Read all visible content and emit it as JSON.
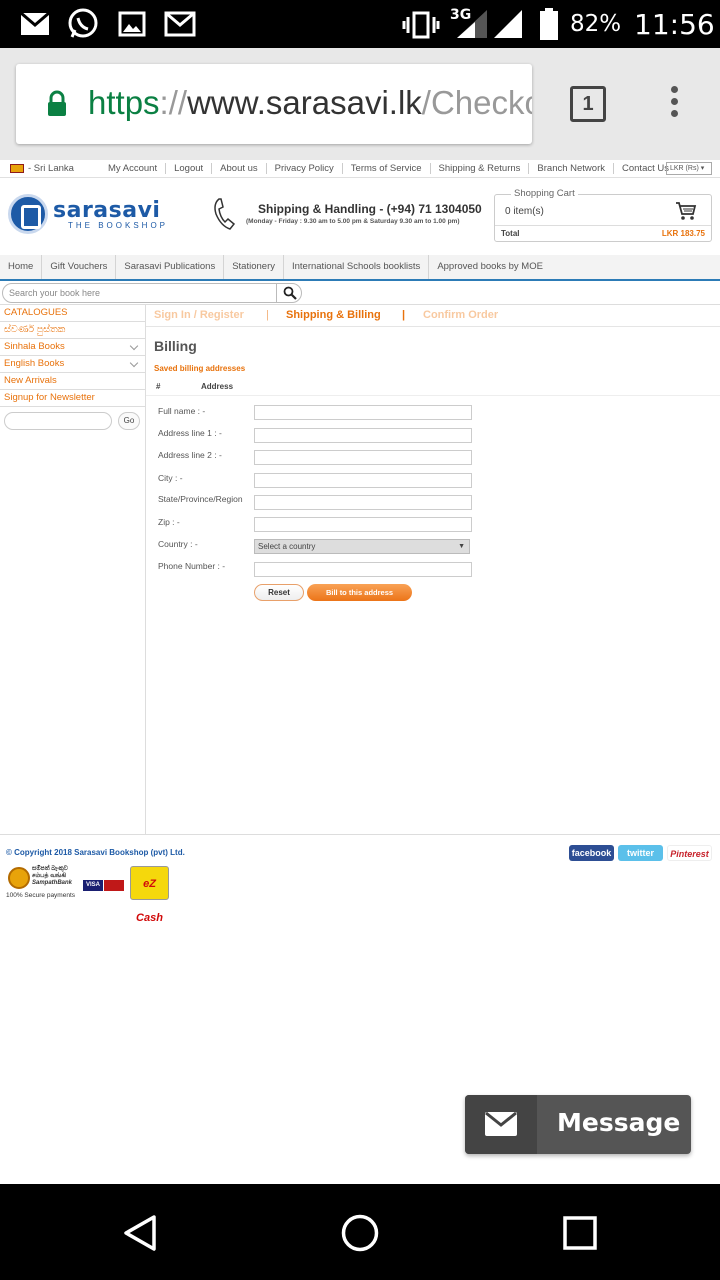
{
  "status_bar": {
    "network": "3G",
    "battery": "82%",
    "time": "11:56"
  },
  "browser": {
    "url_scheme": "https",
    "url_sep": "://",
    "url_host": "www.sarasavi.lk",
    "url_path": "/Checkout",
    "tab_count": "1"
  },
  "top_bar": {
    "country": "- Sri Lanka",
    "links": [
      "My Account",
      "Logout",
      "About us",
      "Privacy Policy",
      "Terms of Service",
      "Shipping & Returns",
      "Branch Network",
      "Contact Us"
    ],
    "currency": "LKR (Rs)"
  },
  "header": {
    "logo_name": "sarasavi",
    "logo_sub": "THE BOOKSHOP",
    "shipping_title": "Shipping & Handling - (+94) 71 1304050",
    "shipping_hours": "(Monday - Friday : 9.30 am to 5.00 pm & Saturday 9.30 am to 1.00 pm)"
  },
  "cart": {
    "title": "Shopping Cart",
    "items": "0 item(s)",
    "total_label": "Total",
    "total_value": "LKR 183.75"
  },
  "main_nav": [
    "Home",
    "Gift Vouchers",
    "Sarasavi Publications",
    "Stationery",
    "International Schools booklists",
    "Approved books by MOE"
  ],
  "search": {
    "placeholder": "Search your book here"
  },
  "sidebar": {
    "items": [
      {
        "label": "CATALOGUES"
      },
      {
        "label": "ස්වර්ණ පුස්තක"
      },
      {
        "label": "Sinhala Books"
      },
      {
        "label": "English Books"
      },
      {
        "label": "New Arrivals"
      },
      {
        "label": "Signup for Newsletter"
      }
    ],
    "go_label": "Go"
  },
  "checkout_steps": {
    "sign_in": "Sign In / Register",
    "sep": "|",
    "shipping": "Shipping & Billing",
    "confirm": "Confirm Order"
  },
  "billing": {
    "title": "Billing",
    "saved_label": "Saved billing addresses",
    "col_num": "#",
    "col_address": "Address",
    "fields": {
      "full_name": "Full name : -",
      "address1": "Address line 1 : -",
      "address2": "Address line 2 : -",
      "city": "City : -",
      "state": "State/Province/Region",
      "zip": "Zip : -",
      "country": "Country : -",
      "phone": "Phone Number : -"
    },
    "country_select": "Select a country",
    "reset_label": "Reset",
    "bill_label": "Bill to this address"
  },
  "footer": {
    "copyright": "© Copyright 2018 Sarasavi Bookshop (pvt) Ltd.",
    "social": [
      "facebook",
      "twitter",
      "Pinterest"
    ],
    "bank_lines": [
      "සම්පත් බැංකුව",
      "சம்பத் வங்கி",
      "SampathBank"
    ],
    "visa": "VISA",
    "ezcash": "eZ Cash",
    "secure": "100% Secure payments"
  },
  "chat": {
    "label": "Message"
  }
}
